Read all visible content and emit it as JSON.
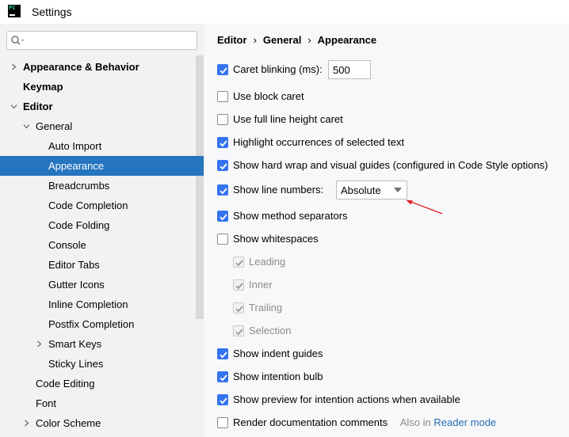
{
  "window": {
    "title": "Settings",
    "app_icon_text": "PC"
  },
  "search": {
    "value": "",
    "placeholder": ""
  },
  "tree": {
    "items": [
      {
        "label": "Appearance & Behavior",
        "bold": true,
        "arrow": "right"
      },
      {
        "label": "Keymap",
        "bold": true
      },
      {
        "label": "Editor",
        "bold": true,
        "arrow": "down"
      },
      {
        "label": "General",
        "arrow": "down"
      },
      {
        "label": "Auto Import"
      },
      {
        "label": "Appearance",
        "selected": true
      },
      {
        "label": "Breadcrumbs"
      },
      {
        "label": "Code Completion"
      },
      {
        "label": "Code Folding"
      },
      {
        "label": "Console"
      },
      {
        "label": "Editor Tabs"
      },
      {
        "label": "Gutter Icons"
      },
      {
        "label": "Inline Completion"
      },
      {
        "label": "Postfix Completion"
      },
      {
        "label": "Smart Keys",
        "arrow": "right"
      },
      {
        "label": "Sticky Lines"
      },
      {
        "label": "Code Editing"
      },
      {
        "label": "Font"
      },
      {
        "label": "Color Scheme",
        "arrow": "right"
      }
    ]
  },
  "breadcrumb": {
    "part1": "Editor",
    "part2": "General",
    "part3": "Appearance",
    "separator": "›"
  },
  "options": {
    "caret_blinking": {
      "label": "Caret blinking (ms):",
      "checked": true,
      "value": "500"
    },
    "block_caret": {
      "label": "Use block caret",
      "checked": false
    },
    "full_line_caret": {
      "label": "Use full line height caret",
      "checked": false
    },
    "highlight_occurrences": {
      "label": "Highlight occurrences of selected text",
      "checked": true
    },
    "hard_wrap": {
      "label": "Show hard wrap and visual guides (configured in Code Style options)",
      "checked": true
    },
    "line_numbers": {
      "label": "Show line numbers:",
      "checked": true,
      "selected": "Absolute"
    },
    "method_separators": {
      "label": "Show method separators",
      "checked": true
    },
    "whitespaces": {
      "label": "Show whitespaces",
      "checked": false
    },
    "leading": {
      "label": "Leading",
      "checked": true,
      "disabled": true
    },
    "inner": {
      "label": "Inner",
      "checked": true,
      "disabled": true
    },
    "trailing": {
      "label": "Trailing",
      "checked": true,
      "disabled": true
    },
    "selection": {
      "label": "Selection",
      "checked": true,
      "disabled": true
    },
    "indent_guides": {
      "label": "Show indent guides",
      "checked": true
    },
    "intention_bulb": {
      "label": "Show intention bulb",
      "checked": true
    },
    "intention_preview": {
      "label": "Show preview for intention actions when available",
      "checked": true
    },
    "render_docs": {
      "label": "Render documentation comments",
      "checked": false,
      "hint_prefix": "Also in",
      "hint_link": "Reader mode"
    }
  },
  "colors": {
    "accent": "#3574f0",
    "selection": "#2675bf",
    "annotation_arrow": "#e0262b",
    "link": "#2470b3"
  },
  "icons": {
    "search": "search-icon",
    "dropdown": "chevron-down-icon",
    "annotation": "red-arrow-icon"
  }
}
